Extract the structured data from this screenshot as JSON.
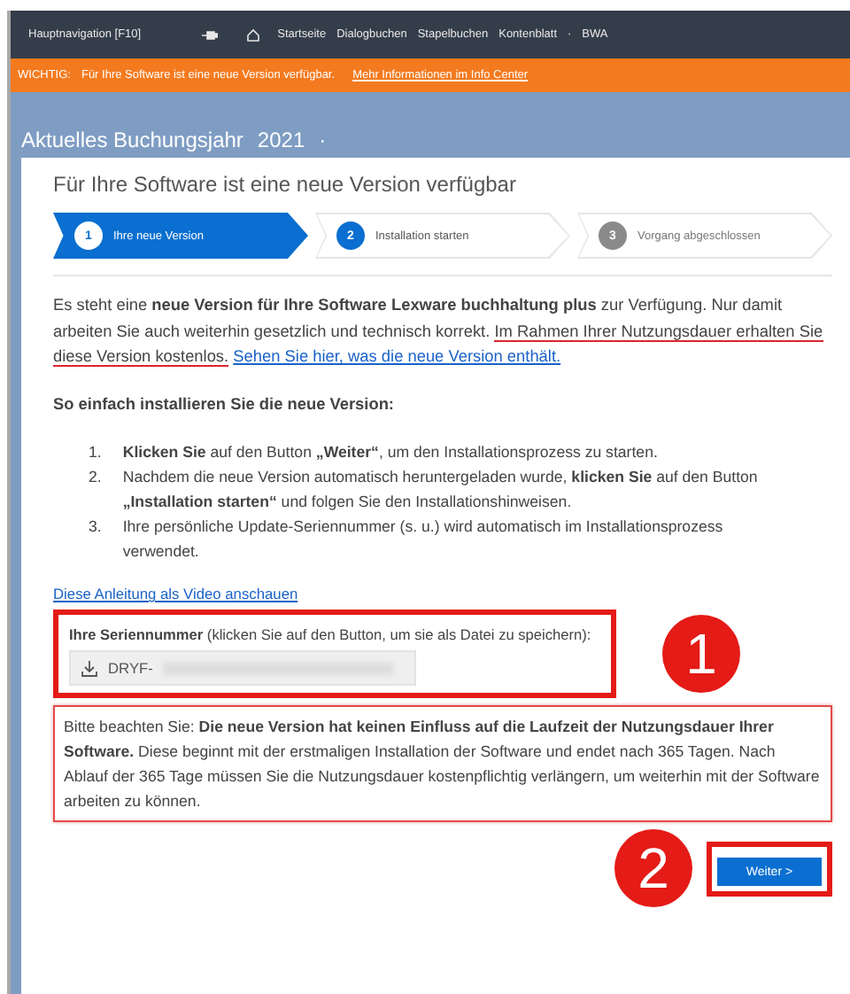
{
  "nav": {
    "title": "Hauptnavigation [F10]",
    "links": [
      "Startseite",
      "Dialogbuchen",
      "Stapelbuchen",
      "Kontenblatt",
      "·",
      "BWA"
    ]
  },
  "notice": {
    "label": "WICHTIG:",
    "text": "Für Ihre Software ist eine neue Version verfügbar.",
    "link": "Mehr Informationen im Info Center"
  },
  "header": {
    "title": "Aktuelles Buchungsjahr",
    "year": "2021",
    "caret": "·"
  },
  "dialog": {
    "title": "Für Ihre Software ist eine neue Version verfügbar",
    "steps": [
      {
        "number": "1",
        "label": "Ihre neue Version",
        "selected": true,
        "disabled": false
      },
      {
        "number": "2",
        "label": "Installation starten",
        "selected": false,
        "disabled": false
      },
      {
        "number": "3",
        "label": "Vorgang abgeschlossen",
        "selected": false,
        "disabled": true
      }
    ],
    "intro": [
      {
        "kind": "plain",
        "text": "Es steht eine **neue Version für Ihre Software Lexware buchhaltung plus** zur Verfügung. Nur damit arbeiten Sie auch weiterhin gesetzlich und technisch korrekt. "
      },
      {
        "kind": "marked",
        "text": "Im Rahmen Ihrer Nutzungsdauer erhalten Sie diese Version kostenlos."
      },
      {
        "kind": "link",
        "text": "Sehen Sie hier, was die neue Version enthält."
      }
    ],
    "howto_title": "So einfach installieren Sie die neue Version:",
    "steps_list": [
      {
        "number": "1.",
        "text": "**Klicken Sie** auf den Button **„Weiter“**, um den Installationsprozess zu starten."
      },
      {
        "number": "2.",
        "text": "Nachdem die neue Version automatisch heruntergeladen wurde, **klicken Sie** auf den Button **„Installation starten“** und folgen Sie den Installationshinweisen."
      },
      {
        "number": "3.",
        "text": "Ihre persönliche Update-Seriennummer (s. u.) wird automatisch im Installationsprozess verwendet."
      }
    ],
    "video_link": "Diese Anleitung als Video anschauen",
    "serial": {
      "label": "**Ihre Seriennummer** (klicken Sie auf den Button, um sie als Datei zu speichern):",
      "value": "DRYF-"
    },
    "note": "Bitte beachten Sie: **Die neue Version hat keinen Einfluss auf die Laufzeit der Nutzungsdauer Ihrer Software.** Diese beginnt mit der erstmaligen Installation der Software und endet nach 365 Tagen. Nach Ablauf der 365 Tage müssen Sie die Nutzungsdauer kostenpflichtig verlängern, um weiterhin mit der Software arbeiten zu können.",
    "next_button": "Weiter >"
  },
  "annotations": [
    "1",
    "2"
  ]
}
